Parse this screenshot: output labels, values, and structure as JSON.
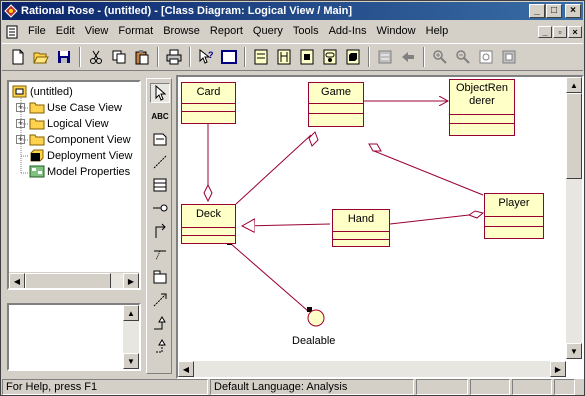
{
  "window": {
    "title": "Rational Rose - (untitled) - [Class Diagram: Logical View / Main]",
    "minimize": "_",
    "maximize": "□",
    "close": "×",
    "mdi_min": "_",
    "mdi_restore": "▫",
    "mdi_close": "×"
  },
  "menu": [
    "File",
    "Edit",
    "View",
    "Format",
    "Browse",
    "Report",
    "Query",
    "Tools",
    "Add-Ins",
    "Window",
    "Help"
  ],
  "toolbar": {
    "icons": [
      "new-icon",
      "open-icon",
      "save-icon",
      "cut-icon",
      "copy-icon",
      "paste-icon",
      "print-icon",
      "context-help-icon",
      "view-doc-icon",
      "browse-class-diagram-icon",
      "browse-interaction-diagram-icon",
      "browse-component-diagram-icon",
      "browse-state-diagram-icon",
      "browse-deployment-diagram-icon",
      "browse-parent-icon",
      "browse-previous-icon",
      "zoom-in-icon",
      "zoom-out-icon",
      "fit-in-window-icon",
      "undo-fit-icon"
    ]
  },
  "browser": {
    "items": [
      {
        "label": "(untitled)",
        "level": 0,
        "icon": "model-icon"
      },
      {
        "label": "Use Case View",
        "level": 1,
        "icon": "folder-icon",
        "expander": "+"
      },
      {
        "label": "Logical View",
        "level": 1,
        "icon": "folder-icon",
        "expander": "+"
      },
      {
        "label": "Component View",
        "level": 1,
        "icon": "folder-icon",
        "expander": "+"
      },
      {
        "label": "Deployment View",
        "level": 1,
        "icon": "deployment-icon"
      },
      {
        "label": "Model Properties",
        "level": 1,
        "icon": "properties-icon"
      }
    ]
  },
  "toolbox": {
    "text_tool": "ABC",
    "tools": [
      "selection-tool",
      "text-tool",
      "note-tool",
      "anchor-note-tool",
      "class-tool",
      "interface-tool",
      "unidirectional-association-tool",
      "package-tool",
      "dependency-tool",
      "generalization-tool",
      "realize-tool"
    ]
  },
  "diagram": {
    "classes": [
      {
        "name": "Card"
      },
      {
        "name": "Game"
      },
      {
        "name": "ObjectRen\nderer",
        "line1": "ObjectRen",
        "line2": "derer"
      },
      {
        "name": "Deck"
      },
      {
        "name": "Hand"
      },
      {
        "name": "Player"
      }
    ],
    "interface": {
      "name": "Dealable"
    }
  },
  "status": {
    "help": "For Help, press F1",
    "language": "Default Language: Analysis"
  },
  "colors": {
    "class_fill": "#ffffc8",
    "class_border": "#990033",
    "title_start": "#0a246a",
    "title_end": "#3a6ea5"
  }
}
